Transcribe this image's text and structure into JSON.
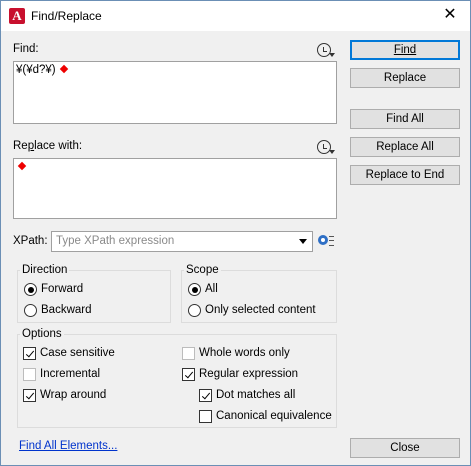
{
  "window": {
    "title": "Find/Replace",
    "app_icon_letter": "A"
  },
  "find": {
    "label": "Find:",
    "value": "¥(¥d?¥)"
  },
  "replace": {
    "label": "Replace with:",
    "value": ""
  },
  "buttons": {
    "find": "Find",
    "replace": "Replace",
    "find_all": "Find All",
    "replace_all": "Replace All",
    "replace_to_end": "Replace to End",
    "close": "Close"
  },
  "xpath": {
    "label": "XPath:",
    "placeholder": "Type XPath expression"
  },
  "direction": {
    "title": "Direction",
    "forward": "Forward",
    "backward": "Backward",
    "selected": "Forward"
  },
  "scope": {
    "title": "Scope",
    "all": "All",
    "only_selected": "Only selected content",
    "selected": "All"
  },
  "options": {
    "title": "Options",
    "case_sensitive": {
      "label": "Case sensitive",
      "checked": true,
      "enabled": true
    },
    "incremental": {
      "label": "Incremental",
      "checked": false,
      "enabled": false
    },
    "wrap_around": {
      "label": "Wrap around",
      "checked": true,
      "enabled": true
    },
    "whole_words_only": {
      "label": "Whole words only",
      "checked": false,
      "enabled": false
    },
    "regular_expression": {
      "label": "Regular expression",
      "checked": true,
      "enabled": true
    },
    "dot_matches_all": {
      "label": "Dot matches all",
      "checked": true,
      "enabled": true
    },
    "canonical_equivalence": {
      "label": "Canonical equivalence",
      "checked": false,
      "enabled": true
    }
  },
  "find_all_elements_link": "Find All Elements...",
  "colors": {
    "accent": "#0078d7",
    "link": "#0033cc",
    "marker": "#e00000",
    "app_icon": "#c8102e"
  },
  "icons": {
    "history": "history-icon",
    "xpath_settings": "gear-icon",
    "close": "close-icon"
  }
}
